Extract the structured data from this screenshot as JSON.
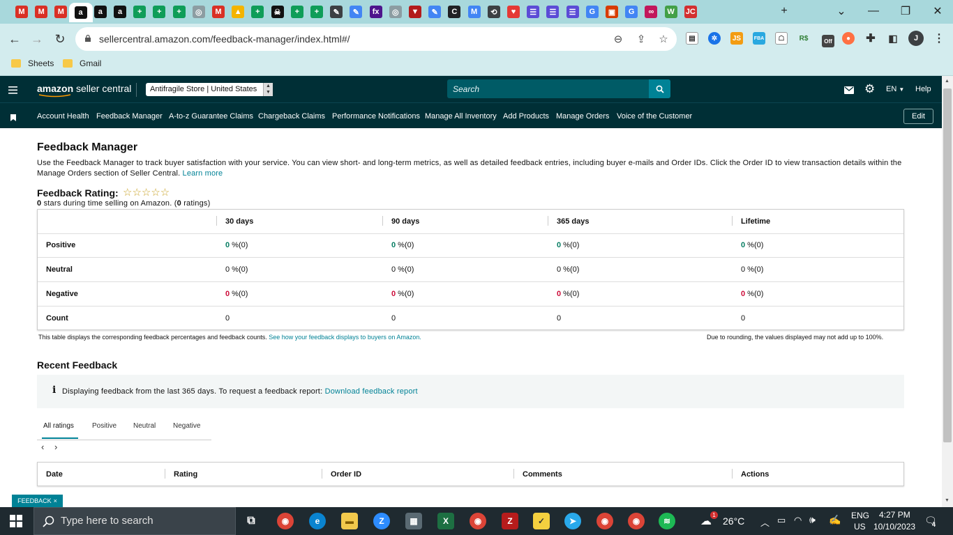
{
  "browser": {
    "tabs": [
      {
        "icon": "gmail-icon",
        "label": "M",
        "color": "#d93025"
      },
      {
        "icon": "gmail-icon",
        "label": "M",
        "color": "#d93025"
      },
      {
        "icon": "gmail-icon",
        "label": "M",
        "color": "#d93025"
      },
      {
        "icon": "amazon-icon",
        "label": "a",
        "color": "#111111",
        "active": true
      },
      {
        "icon": "amazon-icon",
        "label": "a",
        "color": "#111111"
      },
      {
        "icon": "amazon-icon",
        "label": "a",
        "color": "#111111"
      },
      {
        "icon": "sheets-plus-icon",
        "label": "+",
        "color": "#0f9d58"
      },
      {
        "icon": "sheets-plus-icon",
        "label": "+",
        "color": "#0f9d58"
      },
      {
        "icon": "sheets-plus-icon",
        "label": "+",
        "color": "#0f9d58"
      },
      {
        "icon": "globe-icon",
        "label": "◎",
        "color": "#8c9da2"
      },
      {
        "icon": "gmail-icon",
        "label": "M",
        "color": "#d93025"
      },
      {
        "icon": "drive-icon",
        "label": "▲",
        "color": "#f4b400"
      },
      {
        "icon": "sheets-plus-icon",
        "label": "+",
        "color": "#0f9d58"
      },
      {
        "icon": "skull-icon",
        "label": "☠",
        "color": "#111111"
      },
      {
        "icon": "sheets-plus-icon",
        "label": "+",
        "color": "#0f9d58"
      },
      {
        "icon": "sheets-plus-icon",
        "label": "+",
        "color": "#0f9d58"
      },
      {
        "icon": "pen-icon",
        "label": "✎",
        "color": "#3c4043"
      },
      {
        "icon": "pencil-icon",
        "label": "✎",
        "color": "#4285f4"
      },
      {
        "icon": "fedex-icon",
        "label": "fx",
        "color": "#4d148c"
      },
      {
        "icon": "globe-icon",
        "label": "◎",
        "color": "#8c9da2"
      },
      {
        "icon": "shield-icon",
        "label": "▼",
        "color": "#b31b1b"
      },
      {
        "icon": "pencil-icon",
        "label": "✎",
        "color": "#4285f4"
      },
      {
        "icon": "c-icon",
        "label": "C",
        "color": "#202124"
      },
      {
        "icon": "mail-icon",
        "label": "M",
        "color": "#4285f4"
      },
      {
        "icon": "history-icon",
        "label": "⟲",
        "color": "#3c4043"
      },
      {
        "icon": "heart-icon",
        "label": "♥",
        "color": "#e53935"
      },
      {
        "icon": "list-icon",
        "label": "☰",
        "color": "#5b4bd6"
      },
      {
        "icon": "list-icon",
        "label": "☰",
        "color": "#5b4bd6"
      },
      {
        "icon": "list-icon",
        "label": "☰",
        "color": "#5b4bd6"
      },
      {
        "icon": "google-icon",
        "label": "G",
        "color": "#4285f4"
      },
      {
        "icon": "office-icon",
        "label": "▣",
        "color": "#d83b01"
      },
      {
        "icon": "google-icon",
        "label": "G",
        "color": "#4285f4"
      },
      {
        "icon": "signature-icon",
        "label": "∞",
        "color": "#c2185b"
      },
      {
        "icon": "w-icon",
        "label": "W",
        "color": "#43a047"
      },
      {
        "icon": "jc-icon",
        "label": "JC",
        "color": "#d32f2f"
      }
    ],
    "url": "sellercentral.amazon.com/feedback-manager/index.html#/",
    "bookmarks": [
      "Sheets",
      "Gmail"
    ],
    "profile_initial": "J"
  },
  "header": {
    "logo_amazon": "amazon",
    "logo_product": "seller central",
    "store": "Antifragile Store | United States",
    "search_placeholder": "Search",
    "lang": "EN",
    "help": "Help"
  },
  "nav": {
    "items": [
      "Account Health",
      "Feedback Manager",
      "A-to-z Guarantee Claims",
      "Chargeback Claims",
      "Performance Notifications",
      "Manage All Inventory",
      "Add Products",
      "Manage Orders",
      "Voice of the Customer"
    ],
    "edit": "Edit"
  },
  "page": {
    "title": "Feedback Manager",
    "intro": "Use the Feedback Manager to track buyer satisfaction with your service. You can view short- and long-term metrics, as well as detailed feedback entries, including buyer e-mails and Order IDs. Click the Order ID to view transaction details within the Manage Orders section of Seller Central.",
    "learn_more": "Learn more",
    "rating_title": "Feedback Rating:",
    "stars": "☆☆☆☆☆",
    "rating_count_stars": "0",
    "rating_mid": " stars during time selling on Amazon. (",
    "rating_count": "0",
    "rating_end": " ratings)"
  },
  "feedback_table": {
    "columns": [
      "30 days",
      "90 days",
      "365 days",
      "Lifetime"
    ],
    "rows": [
      {
        "label": "Positive",
        "kind": "positive",
        "values": [
          "0",
          "0",
          "0",
          "0"
        ],
        "counts": [
          "(0)",
          "(0)",
          "(0)",
          "(0)"
        ]
      },
      {
        "label": "Neutral",
        "kind": "neutral",
        "values": [
          "0",
          "0",
          "0",
          "0"
        ],
        "counts": [
          "(0)",
          "(0)",
          "(0)",
          "(0)"
        ]
      },
      {
        "label": "Negative",
        "kind": "negative",
        "values": [
          "0",
          "0",
          "0",
          "0"
        ],
        "counts": [
          "(0)",
          "(0)",
          "(0)",
          "(0)"
        ]
      },
      {
        "label": "Count",
        "kind": "count",
        "values": [
          "0",
          "0",
          "0",
          "0"
        ]
      }
    ],
    "percent_sign": " %",
    "note_left": "This table displays the corresponding feedback percentages and feedback counts.",
    "note_link": "See how your feedback displays to buyers on Amazon.",
    "note_right": "Due to rounding, the values displayed may not add up to 100%."
  },
  "recent": {
    "title": "Recent Feedback",
    "info_text": "Displaying feedback from the last 365 days. To request a feedback report:",
    "info_link": "Download feedback report",
    "tabs": [
      "All ratings",
      "Positive",
      "Neutral",
      "Negative"
    ],
    "columns": [
      "Date",
      "Rating",
      "Order ID",
      "Comments",
      "Actions"
    ]
  },
  "feedback_button": "FEEDBACK",
  "taskbar": {
    "search_placeholder": "Type here to search",
    "weather": "26°C",
    "lang_top": "ENG",
    "lang_bottom": "US",
    "time": "4:27 PM",
    "date": "10/10/2023",
    "notifications": "4",
    "weather_badge": "1"
  },
  "colors": {
    "header_bg": "#002f36",
    "accent": "#008296",
    "positive": "#067d62",
    "negative": "#cc0c39"
  }
}
